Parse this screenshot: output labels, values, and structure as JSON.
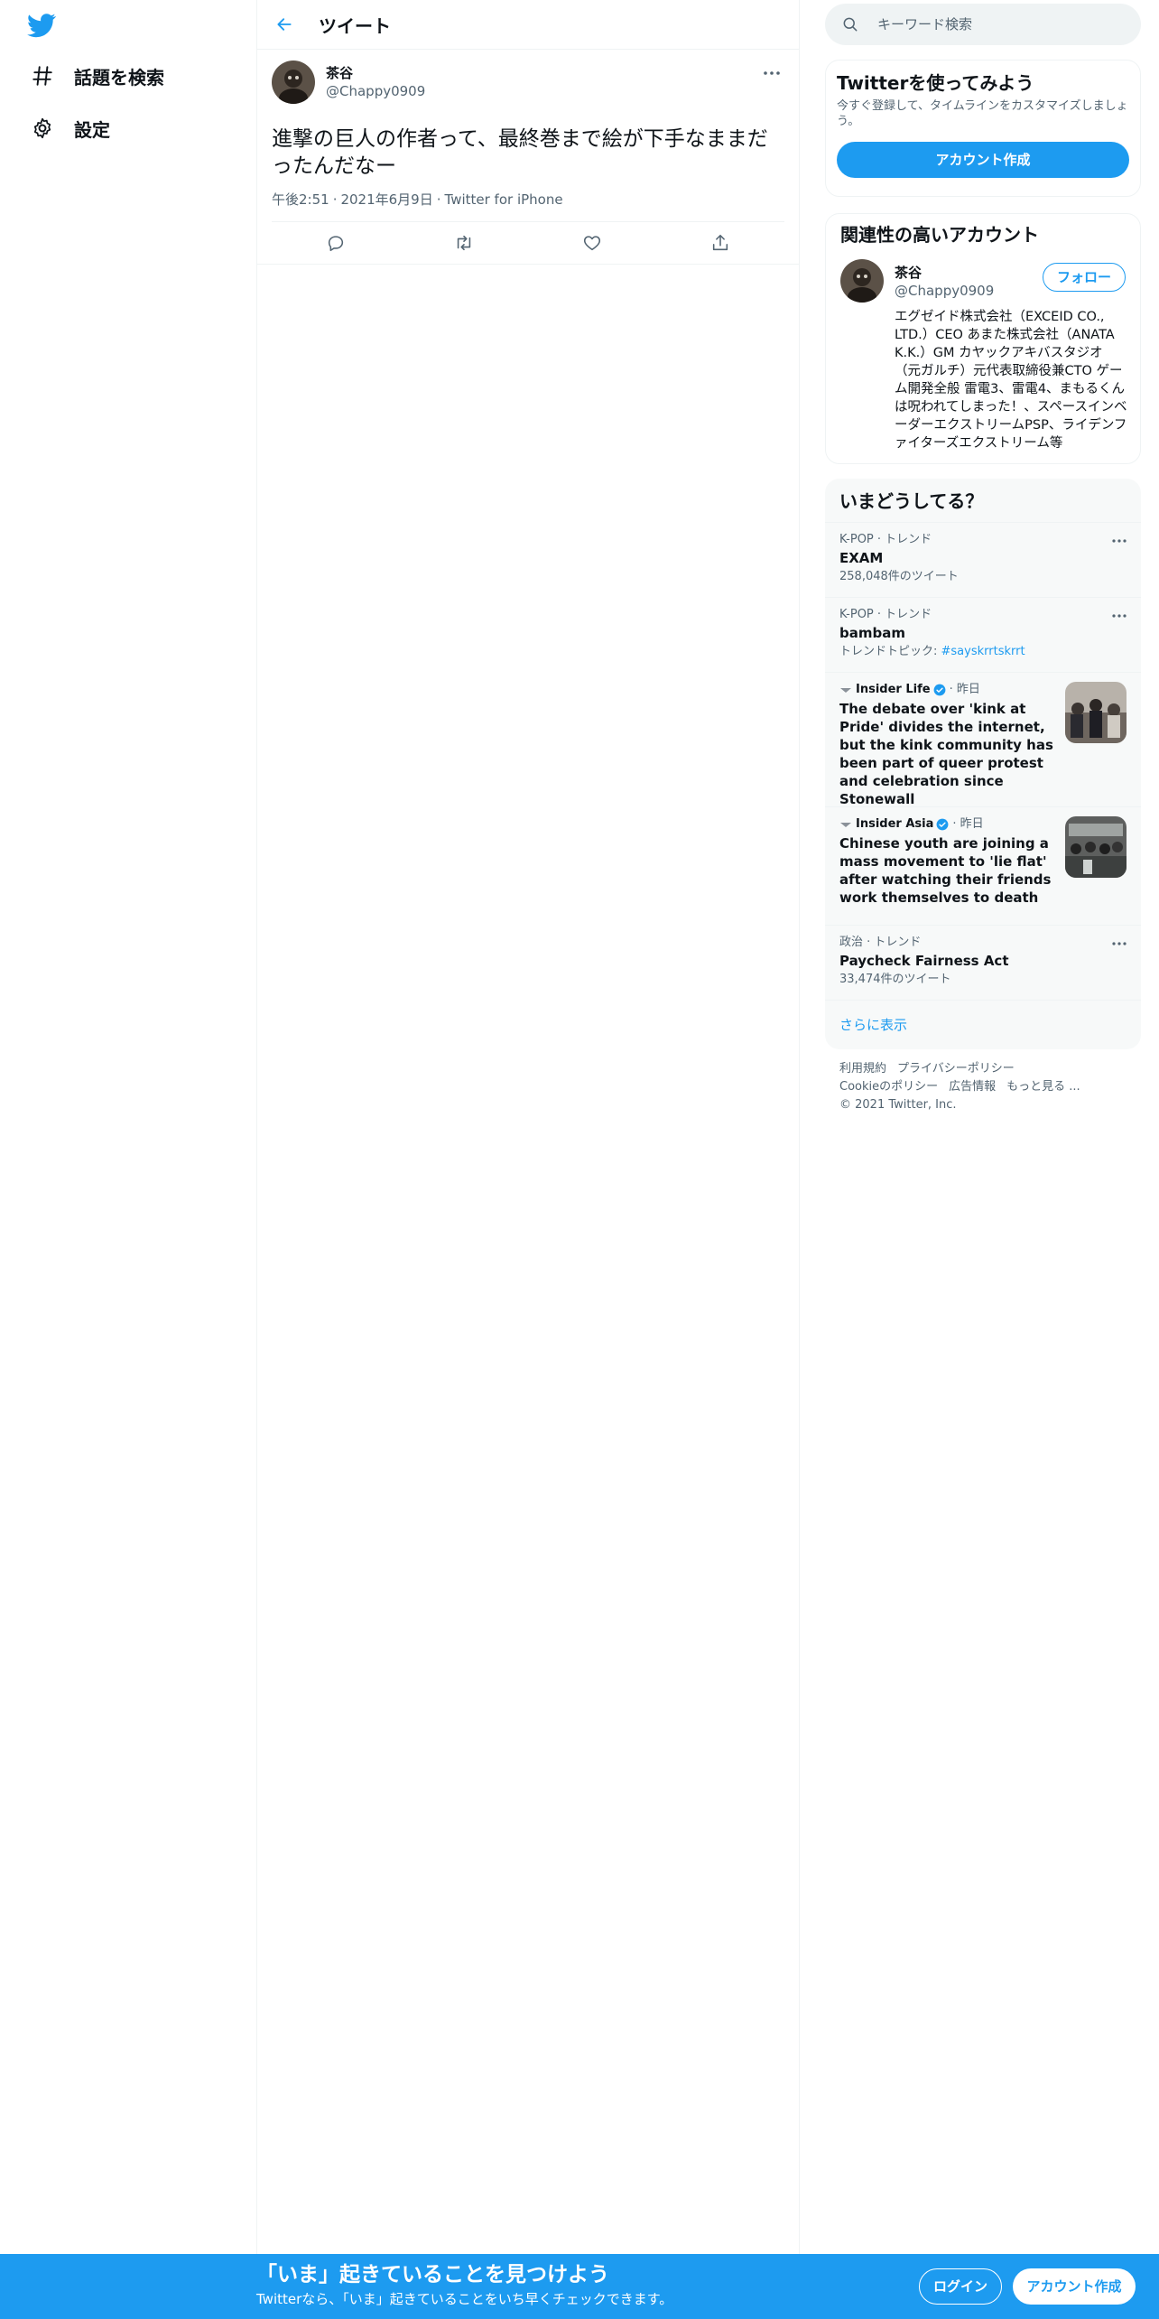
{
  "nav": {
    "items": [
      {
        "label": "話題を検索",
        "icon": "hashtag-icon"
      },
      {
        "label": "設定",
        "icon": "gear-icon"
      }
    ]
  },
  "main": {
    "title": "ツイート",
    "tweet": {
      "author_name": "茶谷",
      "author_handle": "@Chappy0909",
      "text": "進撃の巨人の作者って、最終巻まで絵が下手なままだったんだなー",
      "time": "午後2:51",
      "date": "2021年6月9日",
      "source": "Twitter for iPhone",
      "separator": "·"
    }
  },
  "search": {
    "placeholder": "キーワード検索"
  },
  "signup_card": {
    "title": "Twitterを使ってみよう",
    "subtitle": "今すぐ登録して、タイムラインをカスタマイズしましょう。",
    "button": "アカウント作成"
  },
  "related": {
    "title": "関連性の高いアカウント",
    "user": {
      "name": "茶谷",
      "handle": "@Chappy0909",
      "follow": "フォロー",
      "bio": "エグゼイド株式会社（EXCEID CO., LTD.）CEO あまた株式会社（ANATA K.K.）GM カヤックアキバスタジオ（元ガルチ）元代表取締役兼CTO ゲーム開発全般 雷電3、雷電4、まもるくんは呪われてしまった！、スペースインベーダーエクストリームPSP、ライデンファイターズエクストリーム等"
    }
  },
  "trends": {
    "title": "いまどうしてる？",
    "items": [
      {
        "meta": "K-POP · トレンド",
        "name": "EXAM",
        "count": "258,048件のツイート"
      },
      {
        "meta": "K-POP · トレンド",
        "name": "bambam",
        "count_prefix": "トレンドトピック: ",
        "count_topic": "#sayskrrtskrrt"
      },
      {
        "source": "Insider Life",
        "time": "· 昨日",
        "title": "The debate over 'kink at Pride' divides the internet, but the kink community has been part of queer protest and celebration since Stonewall"
      },
      {
        "source": "Insider Asia",
        "time": "· 昨日",
        "title": "Chinese youth are joining a mass movement to 'lie flat' after watching their friends work themselves to death"
      },
      {
        "meta": "政治 · トレンド",
        "name": "Paycheck Fairness Act",
        "count": "33,474件のツイート"
      }
    ],
    "show_more": "さらに表示"
  },
  "footer": {
    "links": [
      "利用規約",
      "プライバシーポリシー",
      "Cookieのポリシー",
      "広告情報",
      "もっと見る ..."
    ],
    "copyright": "© 2021 Twitter, Inc."
  },
  "bottom_bar": {
    "title": "「いま」起きていることを見つけよう",
    "subtitle": "Twitterなら、「いま」起きていることをいち早くチェックできます。",
    "login": "ログイン",
    "signup": "アカウント作成"
  },
  "colors": {
    "accent": "#1d9bf0",
    "text": "#0f1419",
    "secondary": "#536471",
    "border": "#eff3f4"
  }
}
